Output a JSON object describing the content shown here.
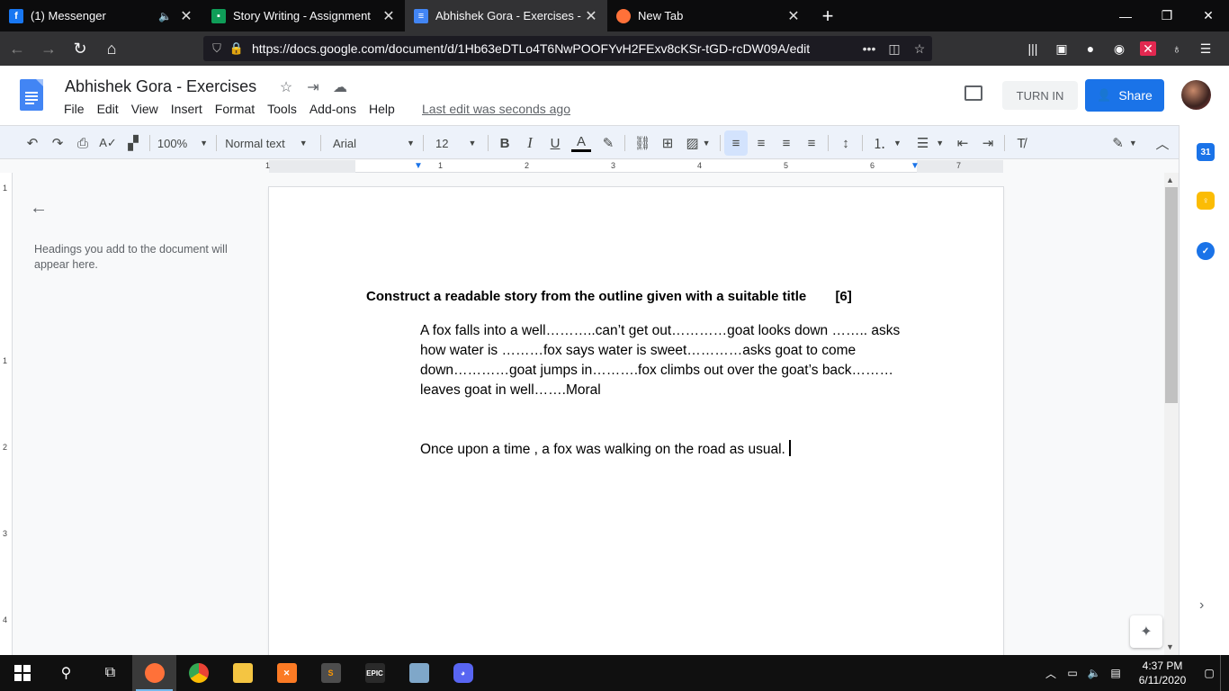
{
  "browser": {
    "tabs": [
      {
        "title": "(1) Messenger",
        "favicon": "facebook-icon",
        "color": "#1877f2",
        "active": false
      },
      {
        "title": "Story Writing - Assignment",
        "favicon": "classroom-icon",
        "color": "#0f9d58",
        "active": false
      },
      {
        "title": "Abhishek Gora - Exercises - Go",
        "favicon": "docs-icon",
        "color": "#4285f4",
        "active": true
      },
      {
        "title": "New Tab",
        "favicon": "firefox-icon",
        "color": "#ff7139",
        "active": false
      }
    ],
    "new_tab_label": "+",
    "url": "https://docs.google.com/document/d/1Hb63eDTLo4T6NwPOOFYvH2FExv8cKSr-tGD-rcDW09A/edit"
  },
  "docs": {
    "title": "Abhishek Gora - Exercises",
    "menu": [
      "File",
      "Edit",
      "View",
      "Insert",
      "Format",
      "Tools",
      "Add-ons",
      "Help"
    ],
    "last_edit": "Last edit was seconds ago",
    "turn_in": "TURN IN",
    "share": "Share",
    "accent": "#1a73e8"
  },
  "toolbar": {
    "zoom": "100%",
    "style": "Normal text",
    "font": "Arial",
    "size": "12"
  },
  "ruler": {
    "numbers": [
      "1",
      "1",
      "2",
      "3",
      "4",
      "5",
      "6",
      "7"
    ],
    "vertical_numbers": [
      "1",
      "1",
      "2",
      "3",
      "4"
    ]
  },
  "outline_panel": {
    "hint": "Headings you add to the document will appear here."
  },
  "document": {
    "heading": "Construct a readable story from the outline given with a suitable title",
    "marks": "[6]",
    "outline": "A fox falls into a well………..can’t get out…………goat looks down …….. asks how water is ………fox says water is sweet…………asks goat to come down…………goat jumps in……….fox climbs out over the goat’s back………leaves goat in well…….Moral",
    "story": "Once upon a time , a fox was walking on the road as usual."
  },
  "side_panel": {
    "calendar_label": "31"
  },
  "taskbar": {
    "epic_label": "EPIC",
    "time": "4:37 PM",
    "date": "6/11/2020"
  }
}
